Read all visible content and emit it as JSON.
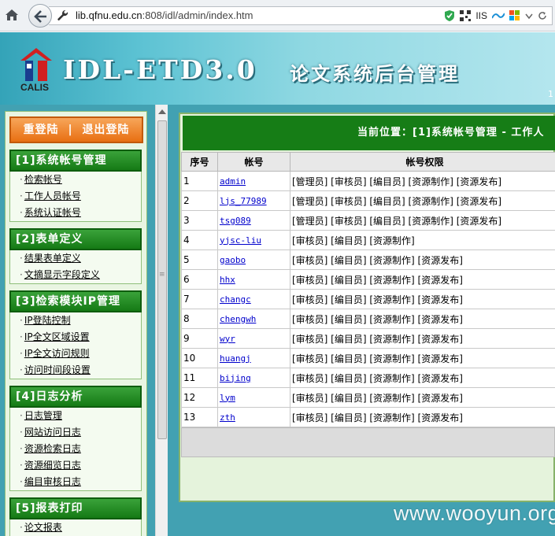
{
  "browser": {
    "url_host": "lib.qfnu.edu.cn",
    "url_rest": ":808/idl/admin/index.htm",
    "iis_label": "IIS"
  },
  "banner": {
    "logo_text": "CALIS",
    "system_name": "IDL-ETD3.0",
    "system_subtitle": "论文系统后台管理",
    "edge_text": "1"
  },
  "sidebar": {
    "relogin": "重登陆",
    "separator": "|",
    "logout": "退出登陆",
    "sections": [
      {
        "title": "[1]系统帐号管理",
        "items": [
          "检索帐号",
          "工作人员帐号",
          "系统认证帐号"
        ]
      },
      {
        "title": "[2]表单定义",
        "items": [
          "结果表单定义",
          "文摘显示字段定义"
        ]
      },
      {
        "title": "[3]检索模块IP管理",
        "items": [
          "IP登陆控制",
          "IP全文区域设置",
          "IP全文访问规则",
          "访问时间段设置"
        ]
      },
      {
        "title": "[4]日志分析",
        "items": [
          "日志管理",
          "网站访问日志",
          "资源检索日志",
          "资源细览日志",
          "编目审核日志"
        ]
      },
      {
        "title": "[5]报表打印",
        "items": [
          "论文报表"
        ]
      }
    ]
  },
  "main": {
    "location": "当前位置：[1]系统帐号管理 - 工作人",
    "columns": [
      "序号",
      "帐号",
      "帐号权限"
    ],
    "rows": [
      {
        "no": "1",
        "account": "admin",
        "rights": "[管理员] [审核员] [编目员] [资源制作] [资源发布]"
      },
      {
        "no": "2",
        "account": "ljs_77989",
        "rights": "[管理员] [审核员] [编目员] [资源制作] [资源发布]"
      },
      {
        "no": "3",
        "account": "tsg089",
        "rights": "[管理员] [审核员] [编目员] [资源制作] [资源发布]"
      },
      {
        "no": "4",
        "account": "yjsc-liu",
        "rights": "[审核员] [编目员] [资源制作]"
      },
      {
        "no": "5",
        "account": "gaobo",
        "rights": "[审核员] [编目员] [资源制作] [资源发布]"
      },
      {
        "no": "6",
        "account": "hhx",
        "rights": "[审核员] [编目员] [资源制作] [资源发布]"
      },
      {
        "no": "7",
        "account": "changc",
        "rights": "[审核员] [编目员] [资源制作] [资源发布]"
      },
      {
        "no": "8",
        "account": "chengwh",
        "rights": "[审核员] [编目员] [资源制作] [资源发布]"
      },
      {
        "no": "9",
        "account": "wyr",
        "rights": "[审核员] [编目员] [资源制作] [资源发布]"
      },
      {
        "no": "10",
        "account": "huangj",
        "rights": "[审核员] [编目员] [资源制作] [资源发布]"
      },
      {
        "no": "11",
        "account": "bijing",
        "rights": "[审核员] [编目员] [资源制作] [资源发布]"
      },
      {
        "no": "12",
        "account": "lym",
        "rights": "[审核员] [编目员] [资源制作] [资源发布]"
      },
      {
        "no": "13",
        "account": "zth",
        "rights": "[审核员] [编目员] [资源制作] [资源发布]"
      }
    ]
  },
  "watermark": "www.wooyun.org",
  "colors": {
    "banner_teal": "#42a1b2",
    "menu_green": "#157a15",
    "relogin_orange": "#e86f12",
    "link_blue": "#0000cc"
  },
  "icons": [
    "home-icon",
    "back-arrow-icon",
    "wrench-icon",
    "shield-icon",
    "qr-icon",
    "dropdown-icon",
    "refresh-icon"
  ]
}
